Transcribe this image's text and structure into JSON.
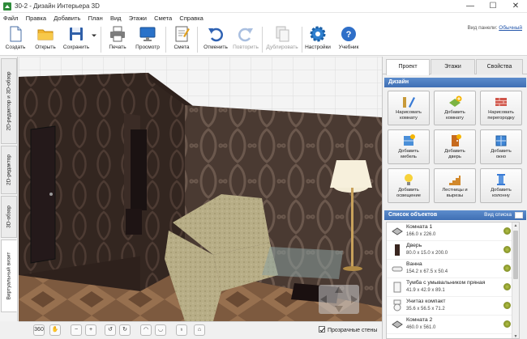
{
  "window": {
    "title": "30-2 - Дизайн Интерьера 3D",
    "minimize": "—",
    "maximize": "☐",
    "close": "✕"
  },
  "menu": [
    "Файл",
    "Правка",
    "Добавить",
    "План",
    "Вид",
    "Этажи",
    "Смета",
    "Справка"
  ],
  "toolbar": {
    "create": "Создать",
    "open": "Открыть",
    "save": "Сохранить",
    "print": "Печать",
    "preview": "Просмотр",
    "estimate": "Смета",
    "undo": "Отменить",
    "redo": "Повторить",
    "duplicate": "Дублировать",
    "settings": "Настройки",
    "tutorial": "Учебник",
    "panel_view_label": "Вид панели:",
    "panel_view_value": "Обычный"
  },
  "side_tabs": [
    "2D-редактор и 3D-обзор",
    "2D-редактор",
    "3D-обзор",
    "Виртуальный визит"
  ],
  "right_panel": {
    "tabs": [
      "Проект",
      "Этажи",
      "Свойства"
    ],
    "design_header": "Дизайн",
    "design_buttons": [
      [
        "Нарисовать",
        "комнату"
      ],
      [
        "Добавить",
        "комнату"
      ],
      [
        "Нарисовать",
        "перегородку"
      ],
      [
        "Добавить",
        "мебель"
      ],
      [
        "Добавить",
        "дверь"
      ],
      [
        "Добавить",
        "окно"
      ],
      [
        "Добавить",
        "освещение"
      ],
      [
        "Лестницы и",
        "вырезы"
      ],
      [
        "Добавить",
        "колонну"
      ]
    ],
    "objects_header": "Список объектов",
    "view_list": "Вид списка",
    "objects": [
      {
        "name": "Комната 1",
        "dims": "166.0 x 226.0"
      },
      {
        "name": "Дверь",
        "dims": "80.0 x 15.0 x 200.0"
      },
      {
        "name": "Ванна",
        "dims": "154.2 x 67.5 x 50.4"
      },
      {
        "name": "Тумба с умывальником пряная",
        "dims": "41.9 x 42.9 x 89.1"
      },
      {
        "name": "Унитаз компакт",
        "dims": "35.6 x 56.5 x 71.2"
      },
      {
        "name": "Комната 2",
        "dims": "460.0 x 561.0"
      }
    ]
  },
  "bottom_bar": {
    "transparent_walls": "Прозрачные стены",
    "transparent_walls_checked": true,
    "btn_360": "360"
  },
  "colors": {
    "accent": "#3f6fb4",
    "header_blue": "#5c8ccc",
    "link": "#2255aa",
    "eye": "#8a9530"
  }
}
